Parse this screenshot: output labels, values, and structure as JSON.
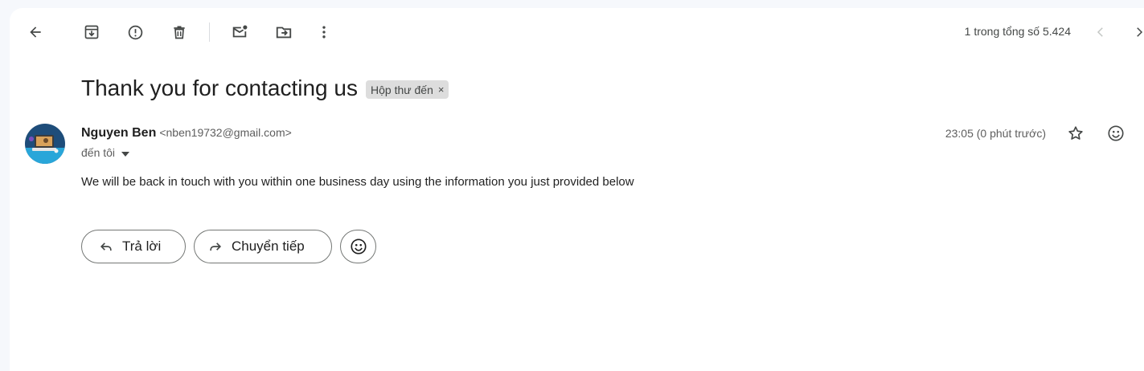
{
  "toolbar": {
    "icons": [
      "back-arrow-icon",
      "archive-icon",
      "report-spam-icon",
      "delete-icon",
      "mark-unread-icon",
      "move-to-icon",
      "more-vert-icon"
    ],
    "pager_text": "1 trong tổng số 5.424"
  },
  "email": {
    "subject": "Thank you for contacting us",
    "label": "Hộp thư đến",
    "label_remove": "×",
    "sender_name": "Nguyen Ben",
    "sender_email": "<nben19732@gmail.com>",
    "to_text": "đến tôi",
    "timestamp": "23:05 (0 phút trước)",
    "body": "We will be back in touch with you within one business day using the information you just provided below"
  },
  "actions": {
    "reply_label": "Trả lời",
    "forward_label": "Chuyển tiếp"
  },
  "colors": {
    "page_bg": "#f6f8fc",
    "panel_bg": "#ffffff",
    "icon": "#444746",
    "chip_bg": "#dddddd",
    "avatar_bg": "#1e4d7a",
    "avatar_accent": "#29a6d9"
  }
}
